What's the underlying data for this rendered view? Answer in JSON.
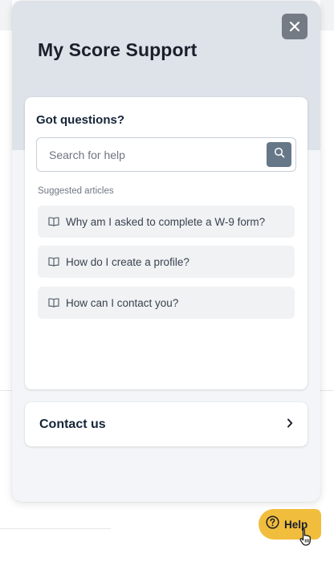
{
  "panel": {
    "title": "My Score Support",
    "close_icon": "close-icon"
  },
  "questions": {
    "heading": "Got questions?",
    "search_placeholder": "Search for help",
    "search_icon": "search-icon",
    "suggested_label": "Suggested articles",
    "articles": [
      {
        "title": "Why am I asked to complete a W-9 form?",
        "icon": "book-icon"
      },
      {
        "title": "How do I create a profile?",
        "icon": "book-icon"
      },
      {
        "title": "How can I contact you?",
        "icon": "book-icon"
      }
    ]
  },
  "contact": {
    "label": "Contact us",
    "icon": "chevron-right-icon"
  },
  "help_button": {
    "label": "Help",
    "icon": "question-circle-icon"
  },
  "colors": {
    "header_bg": "#dee2e9",
    "panel_bg": "#f3f5f8",
    "close_bg": "#757b84",
    "search_button_bg": "#667788",
    "help_button_bg": "#f1bd3c",
    "heading_text": "#152538"
  }
}
